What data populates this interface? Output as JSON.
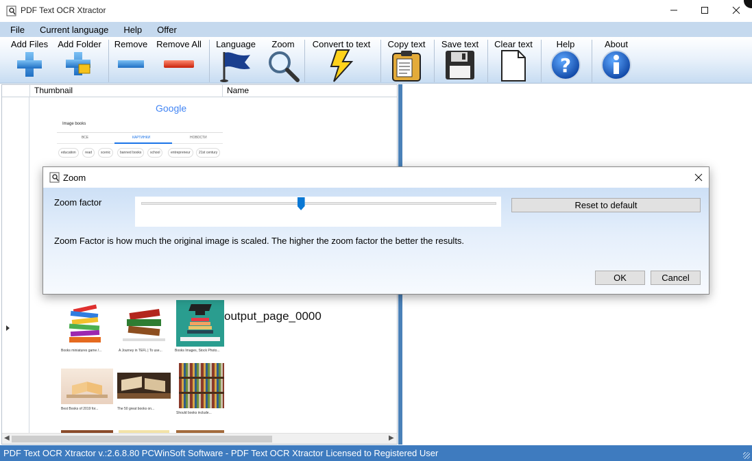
{
  "window": {
    "title": "PDF Text OCR Xtractor"
  },
  "menu": [
    "File",
    "Current language",
    "Help",
    "Offer"
  ],
  "toolbar": {
    "add_files": "Add Files",
    "add_folder": "Add Folder",
    "remove": "Remove",
    "remove_all": "Remove All",
    "language": "Language",
    "zoom": "Zoom",
    "convert": "Convert to text",
    "copy": "Copy text",
    "save": "Save text",
    "clear": "Clear text",
    "help": "Help",
    "about": "About"
  },
  "grid": {
    "col_thumbnail": "Thumbnail",
    "col_name": "Name",
    "row_name": "output_page_0000"
  },
  "thumbnail": {
    "brand": "Google",
    "query": "Image books",
    "tabs": [
      "ВСЕ",
      "КАРТИНКИ",
      "НОВОСТИ"
    ],
    "chips": [
      "education",
      "read",
      "scenic",
      "banned books",
      "school",
      "entrepreneur",
      "21st century"
    ],
    "captions": [
      "Books miniatures game /...",
      "A Journey in TEFL | To use...",
      "Books Images, Stock Photo...",
      "Best Books of 2019 for...",
      "The 50 great books on...",
      "Should books include..."
    ]
  },
  "dialog": {
    "title": "Zoom",
    "zoom_label": "Zoom factor",
    "reset_button": "Reset to default",
    "description": "Zoom Factor is how much the original image is scaled. The higher the zoom factor the better the results.",
    "ok_button": "OK",
    "cancel_button": "Cancel",
    "slider_fraction": 0.45
  },
  "status": {
    "text": "PDF Text OCR Xtractor v.:2.6.8.80 PCWinSoft Software - PDF Text OCR Xtractor Licensed to Registered User"
  },
  "colors": {
    "menubar": "#c5d9ee",
    "statusbar": "#3e7bbf",
    "accent": "#0a78d4",
    "splitter": "#4a81b8"
  }
}
